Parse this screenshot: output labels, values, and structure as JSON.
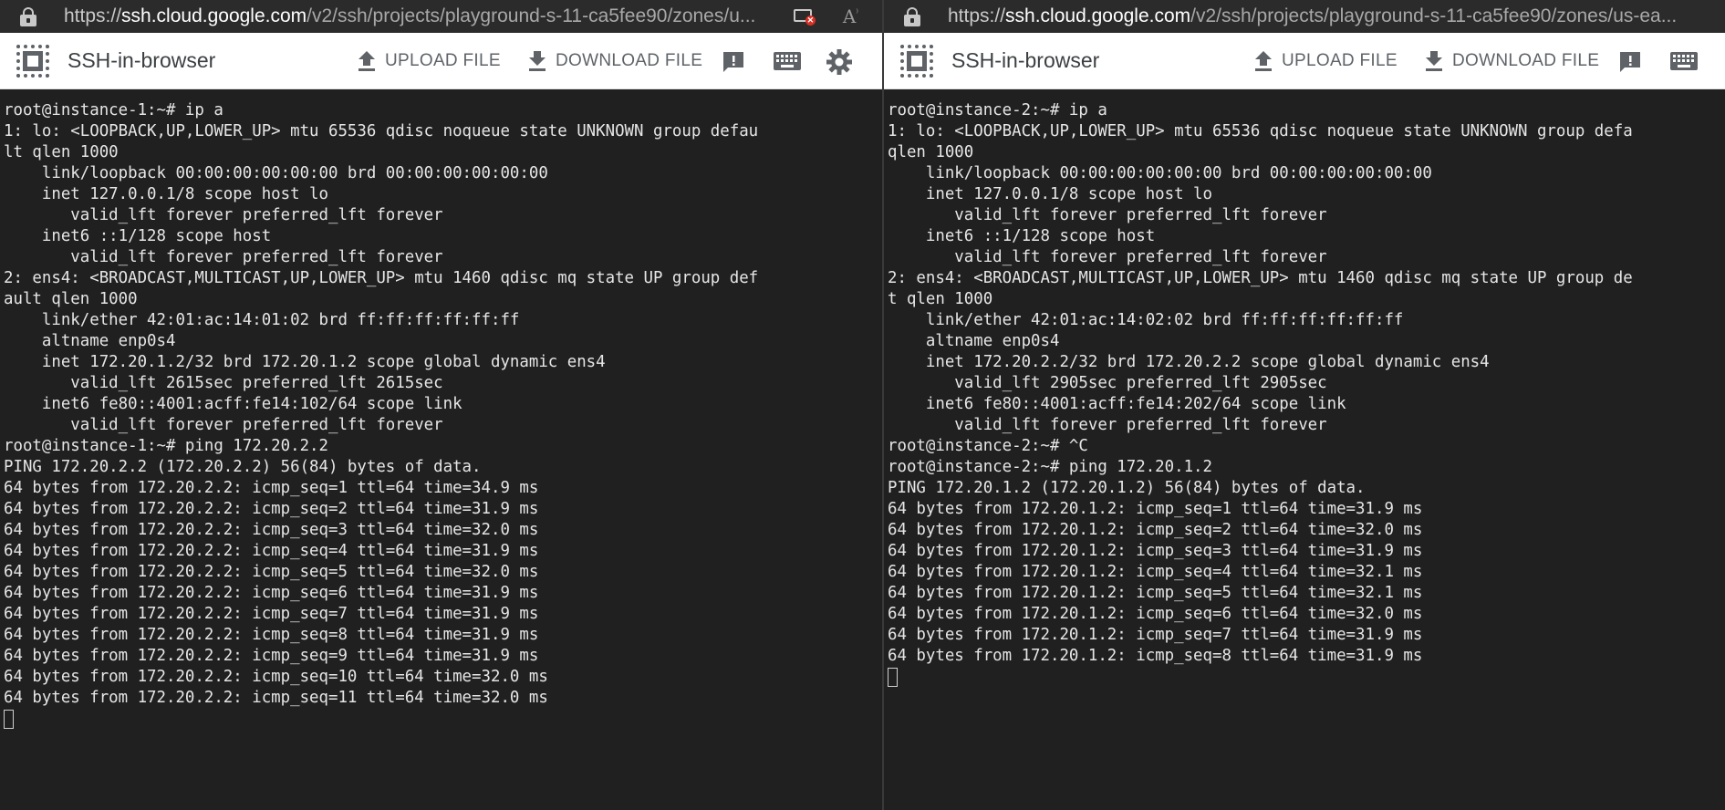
{
  "left": {
    "url": {
      "host_prefix": "https://",
      "host": "ssh.cloud.google.com",
      "path": "/v2/ssh/projects/playground-s-11-ca5fee90/zones/u..."
    },
    "app_title": "SSH-in-browser",
    "upload_label": "UPLOAD FILE",
    "download_label": "DOWNLOAD FILE",
    "lines": [
      "root@instance-1:~# ip a",
      "1: lo: <LOOPBACK,UP,LOWER_UP> mtu 65536 qdisc noqueue state UNKNOWN group defau",
      "lt qlen 1000",
      "    link/loopback 00:00:00:00:00:00 brd 00:00:00:00:00:00",
      "    inet 127.0.0.1/8 scope host lo",
      "       valid_lft forever preferred_lft forever",
      "    inet6 ::1/128 scope host",
      "       valid_lft forever preferred_lft forever",
      "2: ens4: <BROADCAST,MULTICAST,UP,LOWER_UP> mtu 1460 qdisc mq state UP group def",
      "ault qlen 1000",
      "    link/ether 42:01:ac:14:01:02 brd ff:ff:ff:ff:ff:ff",
      "    altname enp0s4",
      "    inet 172.20.1.2/32 brd 172.20.1.2 scope global dynamic ens4",
      "       valid_lft 2615sec preferred_lft 2615sec",
      "    inet6 fe80::4001:acff:fe14:102/64 scope link",
      "       valid_lft forever preferred_lft forever",
      "root@instance-1:~# ping 172.20.2.2",
      "PING 172.20.2.2 (172.20.2.2) 56(84) bytes of data.",
      "64 bytes from 172.20.2.2: icmp_seq=1 ttl=64 time=34.9 ms",
      "64 bytes from 172.20.2.2: icmp_seq=2 ttl=64 time=31.9 ms",
      "64 bytes from 172.20.2.2: icmp_seq=3 ttl=64 time=32.0 ms",
      "64 bytes from 172.20.2.2: icmp_seq=4 ttl=64 time=31.9 ms",
      "64 bytes from 172.20.2.2: icmp_seq=5 ttl=64 time=32.0 ms",
      "64 bytes from 172.20.2.2: icmp_seq=6 ttl=64 time=31.9 ms",
      "64 bytes from 172.20.2.2: icmp_seq=7 ttl=64 time=31.9 ms",
      "64 bytes from 172.20.2.2: icmp_seq=8 ttl=64 time=31.9 ms",
      "64 bytes from 172.20.2.2: icmp_seq=9 ttl=64 time=31.9 ms",
      "64 bytes from 172.20.2.2: icmp_seq=10 ttl=64 time=32.0 ms",
      "64 bytes from 172.20.2.2: icmp_seq=11 ttl=64 time=32.0 ms"
    ]
  },
  "right": {
    "url": {
      "host_prefix": "https://",
      "host": "ssh.cloud.google.com",
      "path": "/v2/ssh/projects/playground-s-11-ca5fee90/zones/us-ea..."
    },
    "app_title": "SSH-in-browser",
    "upload_label": "UPLOAD FILE",
    "download_label": "DOWNLOAD FILE",
    "lines": [
      "root@instance-2:~# ip a",
      "1: lo: <LOOPBACK,UP,LOWER_UP> mtu 65536 qdisc noqueue state UNKNOWN group defa",
      "qlen 1000",
      "    link/loopback 00:00:00:00:00:00 brd 00:00:00:00:00:00",
      "    inet 127.0.0.1/8 scope host lo",
      "       valid_lft forever preferred_lft forever",
      "    inet6 ::1/128 scope host",
      "       valid_lft forever preferred_lft forever",
      "2: ens4: <BROADCAST,MULTICAST,UP,LOWER_UP> mtu 1460 qdisc mq state UP group de",
      "t qlen 1000",
      "    link/ether 42:01:ac:14:02:02 brd ff:ff:ff:ff:ff:ff",
      "    altname enp0s4",
      "    inet 172.20.2.2/32 brd 172.20.2.2 scope global dynamic ens4",
      "       valid_lft 2905sec preferred_lft 2905sec",
      "    inet6 fe80::4001:acff:fe14:202/64 scope link",
      "       valid_lft forever preferred_lft forever",
      "root@instance-2:~# ^C",
      "root@instance-2:~# ping 172.20.1.2",
      "PING 172.20.1.2 (172.20.1.2) 56(84) bytes of data.",
      "64 bytes from 172.20.1.2: icmp_seq=1 ttl=64 time=31.9 ms",
      "64 bytes from 172.20.1.2: icmp_seq=2 ttl=64 time=32.0 ms",
      "64 bytes from 172.20.1.2: icmp_seq=3 ttl=64 time=31.9 ms",
      "64 bytes from 172.20.1.2: icmp_seq=4 ttl=64 time=32.1 ms",
      "64 bytes from 172.20.1.2: icmp_seq=5 ttl=64 time=32.1 ms",
      "64 bytes from 172.20.1.2: icmp_seq=6 ttl=64 time=32.0 ms",
      "64 bytes from 172.20.1.2: icmp_seq=7 ttl=64 time=31.9 ms",
      "64 bytes from 172.20.1.2: icmp_seq=8 ttl=64 time=31.9 ms"
    ]
  },
  "icons": {
    "lock": "lock-icon",
    "extension": "extension-blocked-icon",
    "read_aloud": "read-aloud-icon",
    "chip": "cpu-chip-icon",
    "upload": "upload-icon",
    "download": "download-icon",
    "feedback": "feedback-icon",
    "keyboard": "keyboard-icon",
    "settings": "gear-icon"
  },
  "colors": {
    "terminal_bg": "#202020",
    "terminal_fg": "#e6e6e6",
    "toolbar_bg": "#ffffff",
    "addressbar_bg": "#2b2b2b",
    "icon_gray": "#5f6368"
  }
}
